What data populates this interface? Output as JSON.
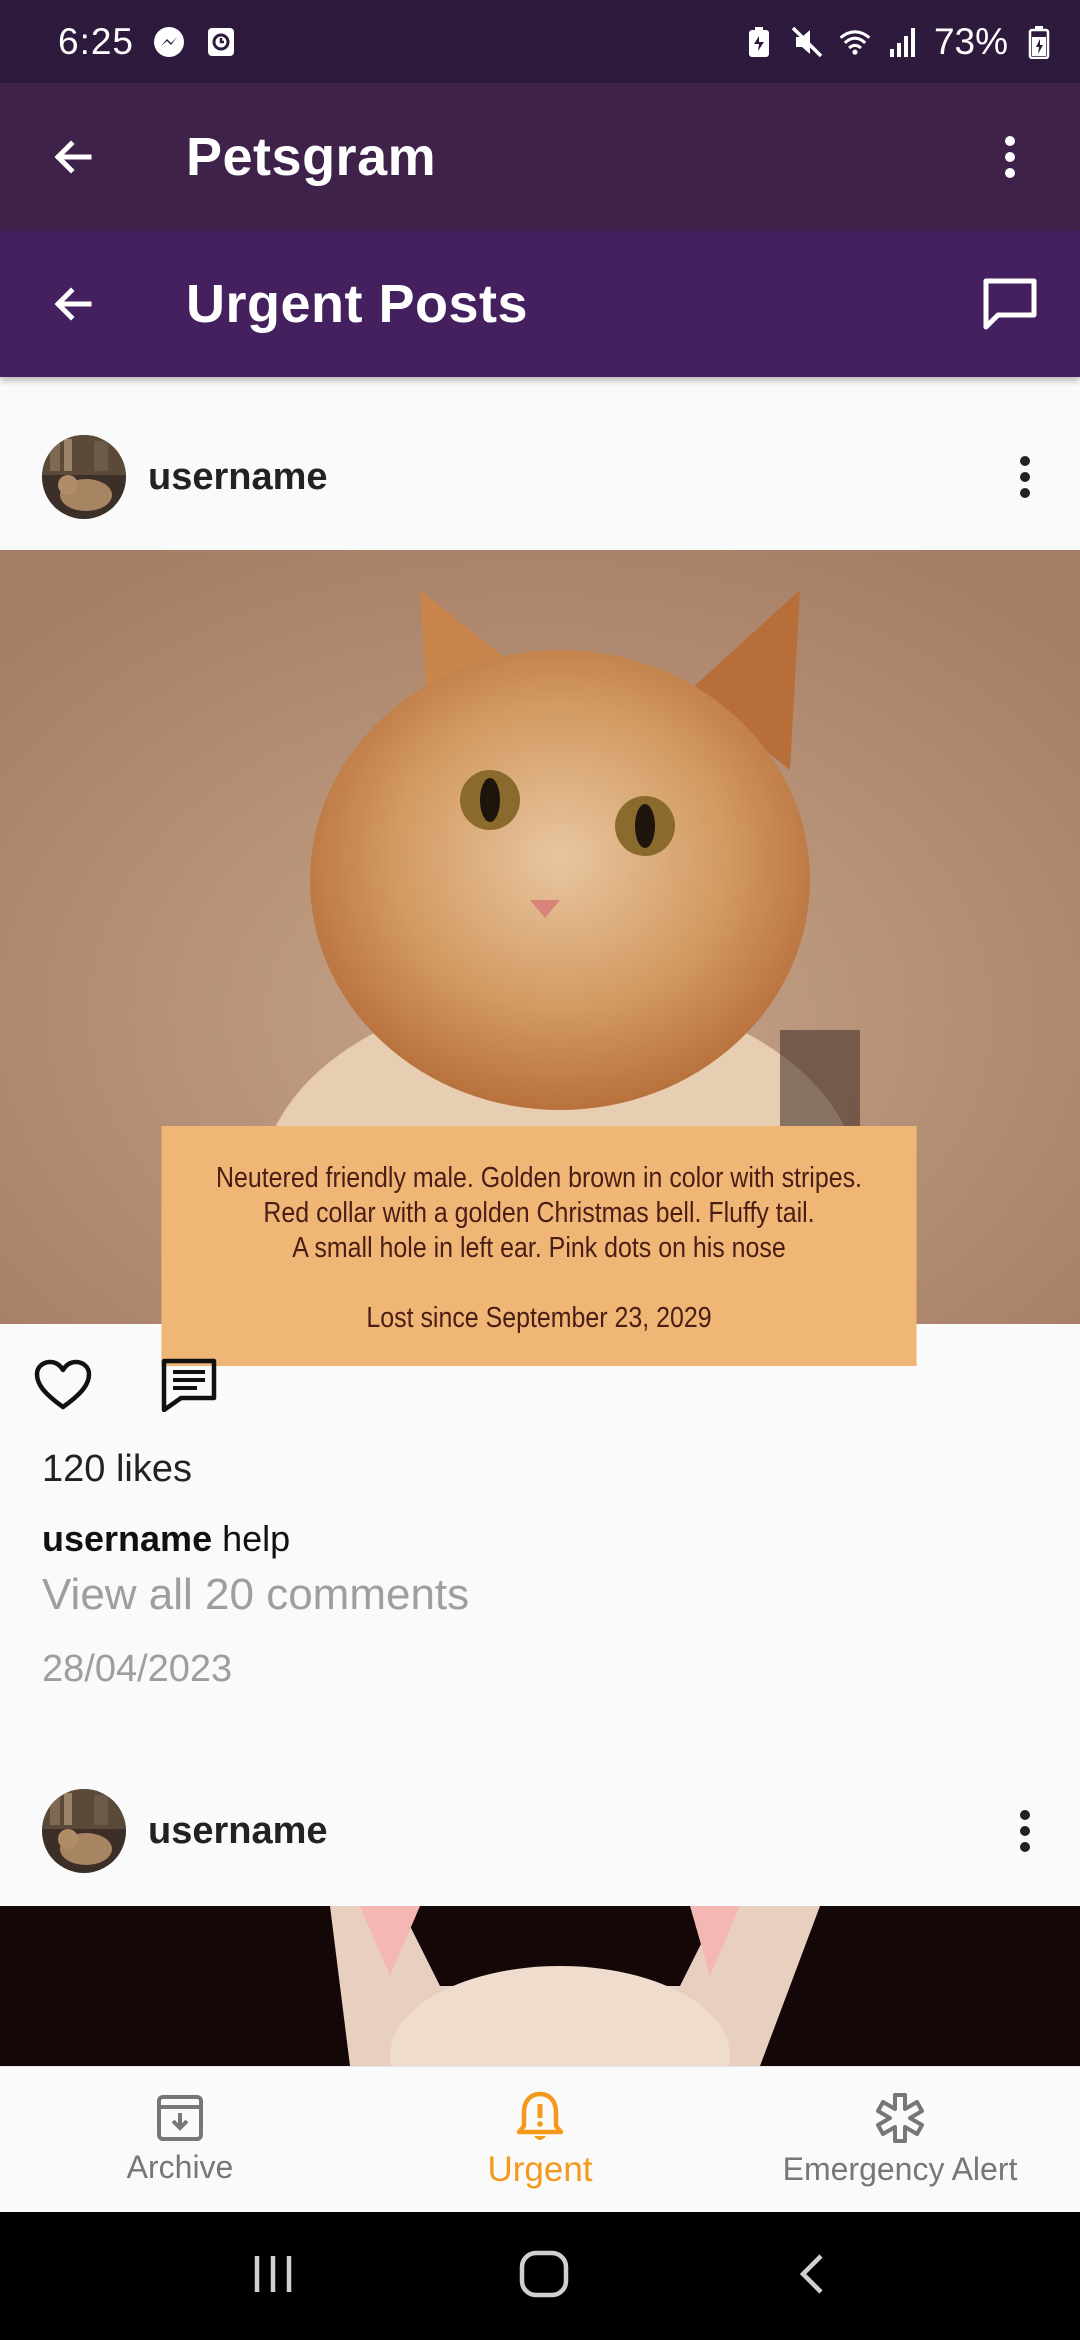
{
  "status_bar": {
    "time": "6:25",
    "battery": "73%",
    "left_icons": [
      "messenger-icon",
      "clock-app-icon"
    ],
    "right_icons": [
      "battery-saver-icon",
      "mute-icon",
      "wifi-icon",
      "signal-icon",
      "battery-icon"
    ]
  },
  "app_bar": {
    "title": "Petsgram"
  },
  "sub_bar": {
    "title": "Urgent Posts"
  },
  "posts": [
    {
      "username": "username",
      "image_caption": [
        "Neutered friendly male. Golden brown in color with stripes.",
        "Red collar with a golden Christmas bell. Fluffy tail.",
        "A small hole in left ear. Pink dots on his nose",
        "Lost since September 23, 2029"
      ],
      "likes": "120 likes",
      "caption_user": "username",
      "caption_text": " help",
      "view_comments": "View all 20 comments",
      "date": "28/04/2023"
    },
    {
      "username": "username"
    }
  ],
  "bottom_nav": {
    "items": [
      {
        "label": "Archive",
        "icon": "archive-icon"
      },
      {
        "label": "Urgent",
        "icon": "alert-bell-icon",
        "active": true
      },
      {
        "label": "Emergency Alert",
        "icon": "asterisk-icon"
      }
    ]
  },
  "colors": {
    "status_bar": "#2e1a3c",
    "app_bar": "#3e2249",
    "sub_bar": "#45205f",
    "accent": "#f39a1c",
    "caption_card": "#efb676"
  }
}
